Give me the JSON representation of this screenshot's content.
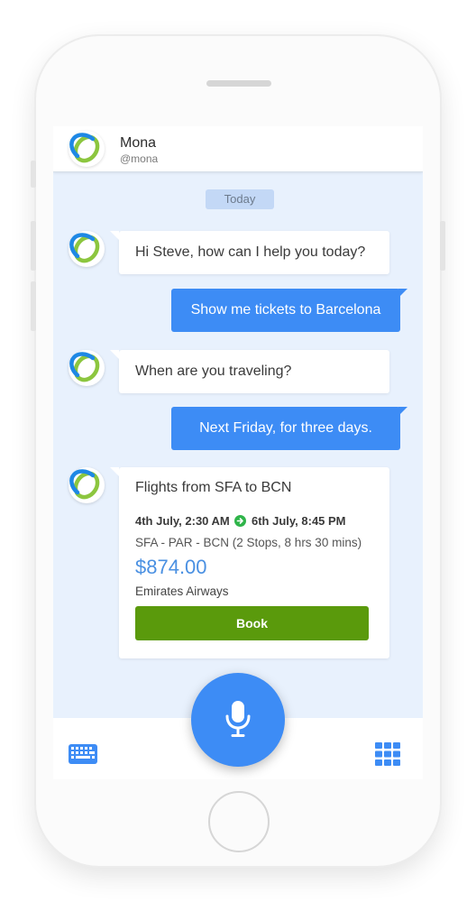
{
  "header": {
    "name": "Mona",
    "handle": "@mona",
    "avatar_icon": "ring-logo-icon"
  },
  "chat": {
    "date_label": "Today",
    "messages": [
      {
        "from": "bot",
        "text": "Hi Steve, how can I help you today?"
      },
      {
        "from": "user",
        "text": "Show me tickets to Barcelona"
      },
      {
        "from": "bot",
        "text": "When are you traveling?"
      },
      {
        "from": "user",
        "text": "Next Friday, for three days."
      }
    ],
    "flight_card": {
      "title": "Flights from SFA to BCN",
      "depart": "4th July, 2:30 AM",
      "return": "6th July, 8:45 PM",
      "route": "SFA - PAR - BCN (2 Stops, 8 hrs 30 mins)",
      "price": "$874.00",
      "airline": "Emirates Airways",
      "book_label": "Book"
    }
  },
  "bottom_bar": {
    "left_icon": "keyboard-icon",
    "center_icon": "microphone-icon",
    "right_icon": "grid-icon"
  },
  "colors": {
    "accent": "#3d8cf5",
    "chat_background": "#e8f1fd",
    "book_button": "#5a9a0c",
    "price": "#4a90e2",
    "arrow": "#2fb44a"
  }
}
